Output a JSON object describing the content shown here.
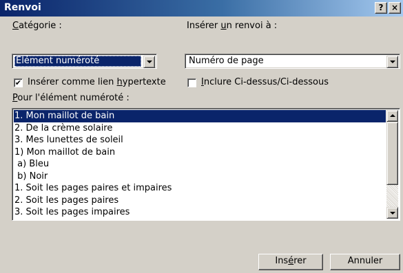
{
  "window": {
    "title": "Renvoi",
    "help_label": "?",
    "close_label": "×"
  },
  "category": {
    "label_before": "",
    "label_accel": "C",
    "label_after": "atégorie :",
    "value": "Élément numéroté"
  },
  "insert_ref": {
    "label_before": "Insérer ",
    "label_accel": "u",
    "label_after": "n renvoi à :",
    "value": "Numéro de page"
  },
  "hyperlink_checkbox": {
    "checked": true,
    "check_mark": "✔",
    "label_before": "Insérer comme lien ",
    "label_accel": "h",
    "label_after": "ypertexte"
  },
  "above_below_checkbox": {
    "checked": false,
    "label_before": "",
    "label_accel": "I",
    "label_after": "nclure Ci-dessus/Ci-dessous"
  },
  "list": {
    "label_before": "",
    "label_accel": "P",
    "label_after": "our l'élément numéroté :",
    "selected_index": 0,
    "items": [
      "1. Mon maillot de bain",
      "2. De la crème solaire",
      "3. Mes lunettes de soleil",
      "1) Mon maillot de bain",
      " a) Bleu",
      " b) Noir",
      "1. Soit les pages paires et impaires",
      "2. Soit les pages paires",
      "3. Soit les pages impaires"
    ]
  },
  "buttons": {
    "insert_before": "Ins",
    "insert_accel": "é",
    "insert_after": "rer",
    "cancel": "Annuler"
  },
  "colors": {
    "title_bar": "#0a246a",
    "selection": "#0a246a",
    "dialog_face": "#d4d0c8"
  }
}
